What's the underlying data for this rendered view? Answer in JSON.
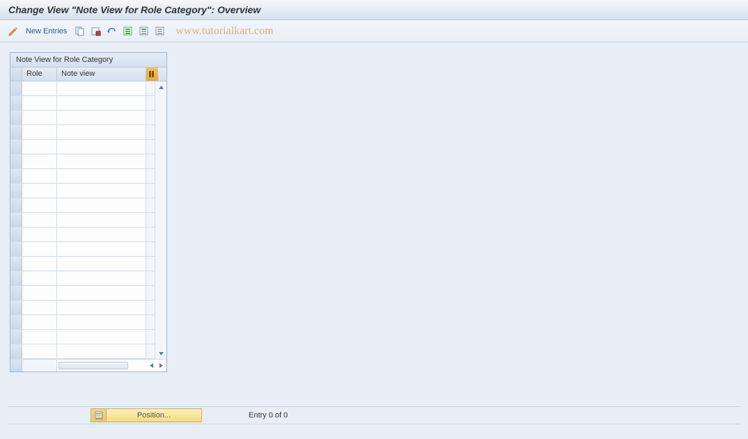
{
  "title": "Change View \"Note View for Role Category\": Overview",
  "toolbar": {
    "new_entries_label": "New Entries"
  },
  "watermark": "www.tutorialkart.com",
  "table": {
    "title": "Note View for Role Category",
    "columns": {
      "role": "Role",
      "note_view": "Note view"
    },
    "row_count": 19
  },
  "footer": {
    "position_label": "Position...",
    "entry_status": "Entry 0 of 0"
  }
}
